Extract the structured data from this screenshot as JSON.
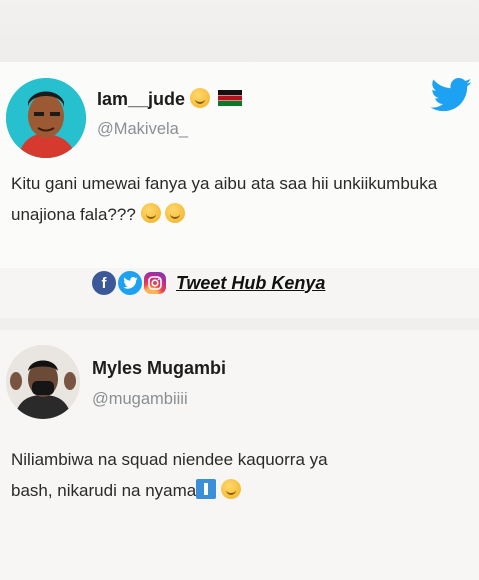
{
  "tweet1": {
    "display_name": "Iam__jude",
    "handle": "@Makivela_",
    "text": "Kitu gani umewai fanya ya aibu ata saa hii unkiikumbuka unajiona fala???",
    "emojis": [
      "smiling-face-emoji",
      "kenya-flag"
    ],
    "text_emojis": [
      "grinning-sweat-emoji",
      "grinning-sweat-emoji"
    ]
  },
  "brand": {
    "label": "Tweet Hub Kenya",
    "icons": [
      "facebook-icon",
      "twitter-icon",
      "instagram-icon"
    ]
  },
  "tweet2": {
    "display_name": "Myles Mugambi",
    "handle": "@mugambiiii",
    "text_line1": "Niliambiwa na squad niendee kaquorra ya",
    "text_line2": "bash, nikarudi na nyama",
    "text_emojis": [
      "up-arrow-sticker",
      "tears-of-joy-emoji"
    ]
  },
  "colors": {
    "twitter_blue": "#1da1f2",
    "handle_gray": "#8a8f94",
    "avatar1_bg": "#27c0cf"
  }
}
